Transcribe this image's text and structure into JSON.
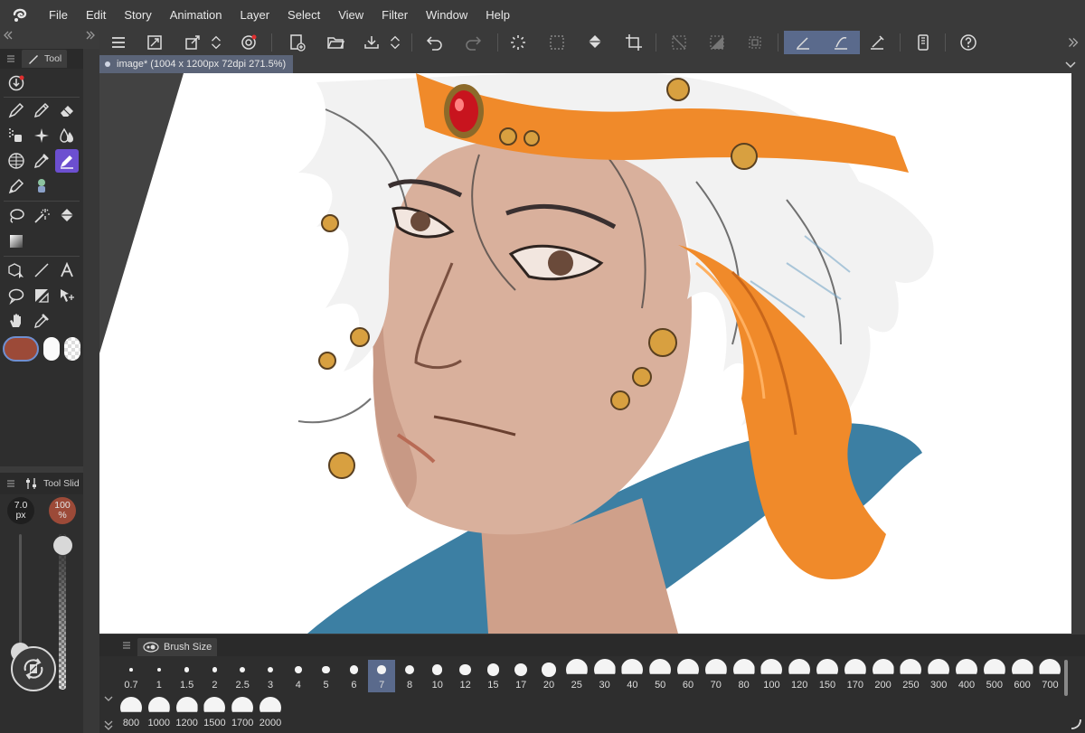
{
  "menu": [
    "File",
    "Edit",
    "Story",
    "Animation",
    "Layer",
    "Select",
    "View",
    "Filter",
    "Window",
    "Help"
  ],
  "canvas": {
    "tab_title": "image* (1004 x 1200px 72dpi 271.5%)"
  },
  "tool_palette": {
    "title": "Tool"
  },
  "tool_slider": {
    "title": "Tool Slid",
    "size_value": "7.0",
    "size_unit": "px",
    "opacity_value": "100",
    "opacity_unit": "%",
    "size_level": 0.1,
    "opacity_level": 1.0
  },
  "colors": {
    "main_color": "#9c4a38",
    "accent": "#6c4fd0",
    "selection": "#5a6a8c",
    "opacity_badge": "#9c4a38"
  },
  "brush_size": {
    "title": "Brush Size",
    "selected": "7",
    "sizes": [
      "0.7",
      "1",
      "1.5",
      "2",
      "2.5",
      "3",
      "4",
      "5",
      "6",
      "7",
      "8",
      "10",
      "12",
      "15",
      "17",
      "20",
      "25",
      "30",
      "40",
      "50",
      "60",
      "70",
      "80",
      "100",
      "120",
      "150",
      "170",
      "200",
      "250",
      "300",
      "400",
      "500",
      "600",
      "700",
      "800",
      "1000",
      "1200",
      "1500",
      "1700",
      "2000"
    ]
  }
}
